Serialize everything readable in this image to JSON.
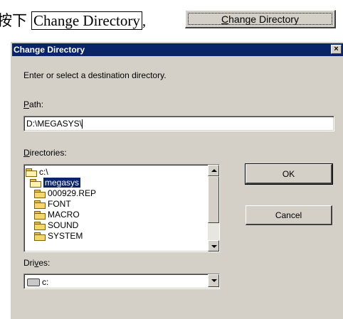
{
  "instruction": {
    "prefix": "按下",
    "target": "Change Directory",
    "suffix": ","
  },
  "top_button": {
    "label": "Change Directory",
    "mnemonic": "C",
    "rest": "hange Directory"
  },
  "dialog": {
    "title": "Change Directory",
    "close_glyph": "×",
    "prompt": "Enter or select a destination directory.",
    "path_label": {
      "mnemonic": "P",
      "rest": "ath:"
    },
    "path_value": "D:\\MEGASYS\\",
    "directories_label": {
      "mnemonic": "D",
      "rest": "irectories:"
    },
    "directories": [
      {
        "name": "c:\\",
        "indent": 0,
        "icon": "open-folder-icon",
        "selected": false
      },
      {
        "name": "megasys",
        "indent": 1,
        "icon": "open-folder-icon",
        "selected": true
      },
      {
        "name": "000929.REP",
        "indent": 2,
        "icon": "folder-icon",
        "selected": false
      },
      {
        "name": "FONT",
        "indent": 2,
        "icon": "folder-icon",
        "selected": false
      },
      {
        "name": "MACRO",
        "indent": 2,
        "icon": "folder-icon",
        "selected": false
      },
      {
        "name": "SOUND",
        "indent": 2,
        "icon": "folder-icon",
        "selected": false
      },
      {
        "name": "SYSTEM",
        "indent": 2,
        "icon": "folder-icon",
        "selected": false
      }
    ],
    "ok_label": "OK",
    "cancel_label": "Cancel",
    "drives_label": {
      "pre": "Dri",
      "mnemonic": "v",
      "rest": "es:"
    },
    "drive_value": "c:"
  },
  "colors": {
    "title_bar": "#0a246a",
    "face": "#d4d0c8",
    "selection": "#0a246a"
  }
}
